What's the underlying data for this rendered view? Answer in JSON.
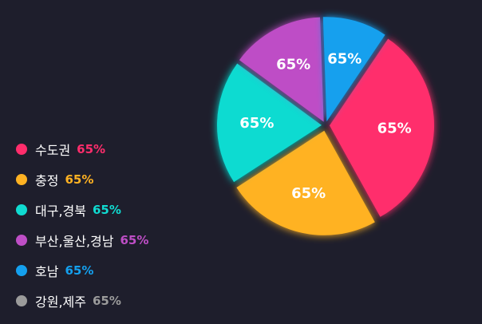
{
  "chart_data": {
    "type": "pie",
    "title": "",
    "start_angle_deg": 34,
    "categories": [
      "수도권",
      "충정",
      "대구,경북",
      "부산,울산,경남",
      "호남",
      "강원,제주"
    ],
    "slices": [
      {
        "label": "수도권",
        "share": 0.325,
        "display_value": "65%",
        "color": "#ff2d6c",
        "explode": 5
      },
      {
        "label": "충정",
        "share": 0.239,
        "display_value": "65%",
        "color": "#ffb222",
        "explode": 7
      },
      {
        "label": "대구,경북",
        "share": 0.192,
        "display_value": "65%",
        "color": "#10dbd1",
        "explode": 5
      },
      {
        "label": "부산,울산,경남",
        "share": 0.144,
        "display_value": "65%",
        "color": "#be4ec6",
        "explode": 5
      },
      {
        "label": "호남",
        "share": 0.1,
        "display_value": "65%",
        "color": "#14a0ee",
        "explode": 5
      },
      {
        "label": "강원,제주",
        "share": 0,
        "display_value": "65%",
        "color": "#9b9b9b",
        "explode": 0
      }
    ],
    "legend": {
      "position": "left",
      "items": [
        {
          "label": "수도권",
          "value": "65%",
          "color": "#ff2d6c"
        },
        {
          "label": "충정",
          "value": "65%",
          "color": "#ffb222"
        },
        {
          "label": "대구,경북",
          "value": "65%",
          "color": "#10dbd1"
        },
        {
          "label": "부산,울산,경남",
          "value": "65%",
          "color": "#be4ec6"
        },
        {
          "label": "호남",
          "value": "65%",
          "color": "#14a0ee"
        },
        {
          "label": "강원,제주",
          "value": "65%",
          "color": "#9b9b9b"
        }
      ]
    },
    "background": "#1e1e2c"
  }
}
